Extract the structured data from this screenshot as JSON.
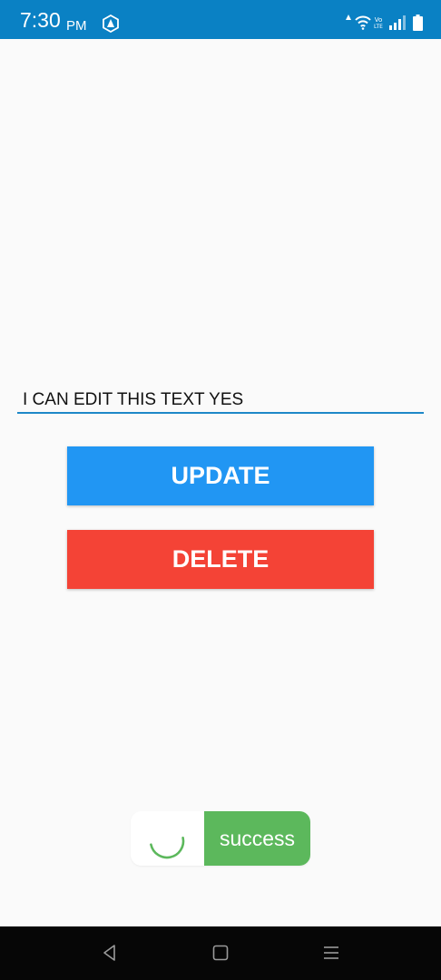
{
  "status_bar": {
    "time": "7:30",
    "ampm": "PM",
    "color": "#0a81c4",
    "icons": [
      "app-shield-icon",
      "data-arrow-icon",
      "wifi-icon",
      "volte-icon",
      "signal-icon",
      "battery-icon"
    ],
    "volte_label_top": "Vo",
    "volte_label_bottom": "LTE"
  },
  "editor": {
    "value": "I CAN EDIT THIS TEXT YES",
    "underline_color": "#1e88c8"
  },
  "buttons": {
    "update_label": "UPDATE",
    "update_color": "#2196f3",
    "delete_label": "DELETE",
    "delete_color": "#f44336"
  },
  "toast": {
    "label": "success",
    "color": "#5cb85c",
    "icon": "loading-spinner-icon"
  },
  "nav_bar": {
    "icons": [
      "back-icon",
      "home-icon",
      "menu-icon"
    ]
  }
}
